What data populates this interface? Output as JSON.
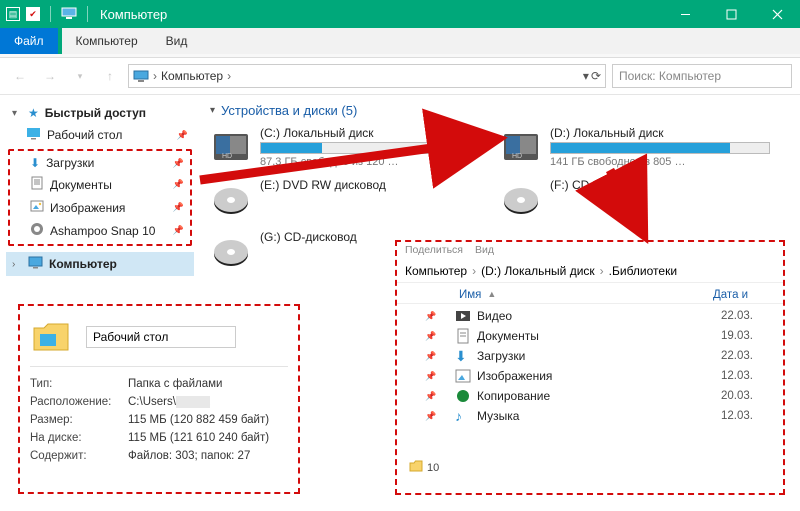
{
  "title": "Компьютер",
  "ribbon": {
    "file": "Файл",
    "tabs": [
      "Компьютер",
      "Вид"
    ]
  },
  "addressbar": {
    "crumb": "Компьютер"
  },
  "search": {
    "placeholder": "Поиск: Компьютер"
  },
  "sidebar": {
    "quick_access": "Быстрый доступ",
    "desktop": "Рабочий стол",
    "items": [
      {
        "label": "Загрузки"
      },
      {
        "label": "Документы"
      },
      {
        "label": "Изображения"
      },
      {
        "label": "Ashampoo Snap 10"
      }
    ],
    "computer": "Компьютер"
  },
  "group_header": "Устройства и диски (5)",
  "drives": {
    "c": {
      "title": "(C:) Локальный диск",
      "sub": "87,3 ГБ свободно из 120 …",
      "fill": 28
    },
    "d": {
      "title": "(D:) Локальный диск",
      "sub": "141 ГБ свободно из 805 …",
      "fill": 82
    },
    "e": {
      "title": "(E:) DVD RW дисковод"
    },
    "f": {
      "title": "(F:) CD-дисковод"
    },
    "g": {
      "title": "(G:) CD-дисковод"
    }
  },
  "props": {
    "name_value": "Рабочий стол",
    "type_label": "Тип:",
    "type_value": "Папка с файлами",
    "loc_label": "Расположение:",
    "loc_value": "C:\\Users\\",
    "size_label": "Размер:",
    "size_value": "115 МБ (120 882 459 байт)",
    "ondisk_label": "На диске:",
    "ondisk_value": "115 МБ (121 610 240 байт)",
    "contains_label": "Содержит:",
    "contains_value": "Файлов: 303; папок: 27"
  },
  "lib": {
    "top_tabs": [
      "Поделиться",
      "Вид"
    ],
    "crumbs": [
      "Компьютер",
      "(D:) Локальный диск",
      ".Библиотеки"
    ],
    "col_name": "Имя",
    "col_date": "Дата и",
    "rows": [
      {
        "name": "Видео",
        "date": "22.03."
      },
      {
        "name": "Документы",
        "date": "19.03."
      },
      {
        "name": "Загрузки",
        "date": "22.03."
      },
      {
        "name": "Изображения",
        "date": "12.03."
      },
      {
        "name": "Копирование",
        "date": "20.03."
      },
      {
        "name": "Музыка",
        "date": "12.03."
      }
    ],
    "count": "10"
  }
}
